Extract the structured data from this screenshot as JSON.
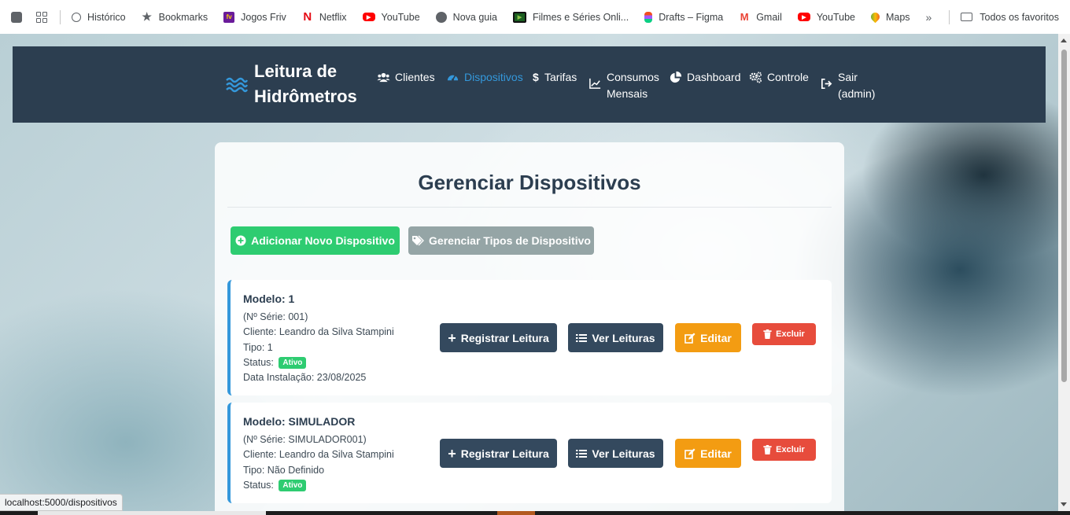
{
  "bookmarks": [
    {
      "label": "Histórico",
      "icon": "history-icon"
    },
    {
      "label": "Bookmarks",
      "icon": "star-icon"
    },
    {
      "label": "Jogos Friv",
      "icon": "friv-icon"
    },
    {
      "label": "Netflix",
      "icon": "netflix-icon"
    },
    {
      "label": "YouTube",
      "icon": "youtube-icon"
    },
    {
      "label": "Nova guia",
      "icon": "globe-icon"
    },
    {
      "label": "Filmes e Séries Onli...",
      "icon": "tv-icon"
    },
    {
      "label": "Drafts – Figma",
      "icon": "figma-icon"
    },
    {
      "label": "Gmail",
      "icon": "gmail-icon"
    },
    {
      "label": "YouTube",
      "icon": "youtube-icon"
    },
    {
      "label": "Maps",
      "icon": "maps-icon"
    }
  ],
  "bookmarks_more": "»",
  "all_favorites": "Todos os favoritos",
  "brand": {
    "title": "Leitura de Hidrômetros"
  },
  "nav": {
    "clientes": "Clientes",
    "dispositivos": "Dispositivos",
    "tarifas": "Tarifas",
    "consumos_line1": "Consumos",
    "consumos_line2": "Mensais",
    "dashboard": "Dashboard",
    "controle": "Controle",
    "sair_line1": "Sair",
    "sair_line2": "(admin)"
  },
  "page": {
    "title": "Gerenciar Dispositivos",
    "add_button": "Adicionar Novo Dispositivo",
    "types_button": "Gerenciar Tipos de Dispositivo"
  },
  "devices": [
    {
      "model": "Modelo: 1",
      "serial": "(Nº Série: 001)",
      "client": "Cliente: Leandro da Silva Stampini",
      "type": "Tipo: 1",
      "status_label": "Status:",
      "status": "Ativo",
      "install": "Data Instalação: 23/08/2025"
    },
    {
      "model": "Modelo: SIMULADOR",
      "serial": "(Nº Série: SIMULADOR001)",
      "client": "Cliente: Leandro da Silva Stampini",
      "type": "Tipo: Não Definido",
      "status_label": "Status:",
      "status": "Ativo"
    }
  ],
  "device_actions": {
    "register": "Registrar Leitura",
    "view": "Ver Leituras",
    "edit": "Editar",
    "delete": "Excluir"
  },
  "status_url": "localhost:5000/dispositivos",
  "colors": {
    "navbar": "#2c3e50",
    "active": "#3498db",
    "success": "#2ecc71",
    "secondary": "#95a5a6",
    "dark_button": "#34495e",
    "warning": "#f39c12",
    "danger": "#e74c3c"
  }
}
